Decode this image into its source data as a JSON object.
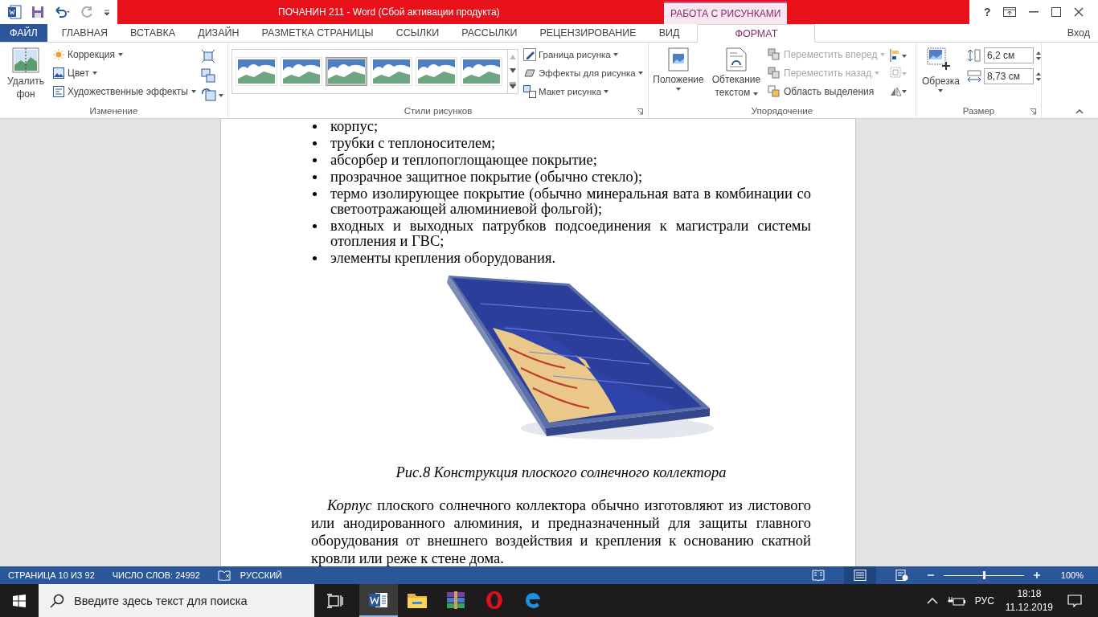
{
  "window": {
    "title": "ПОЧАНИН 211 -  Word (Сбой активации продукта)",
    "context_tab": "РАБОТА С РИСУНКАМИ",
    "help": "?",
    "sign_in": "Вход"
  },
  "tabs": [
    {
      "label": "ФАЙЛ",
      "kind": "file",
      "selected": false
    },
    {
      "label": "ГЛАВНАЯ",
      "kind": "tab",
      "selected": false
    },
    {
      "label": "ВСТАВКА",
      "kind": "tab",
      "selected": false
    },
    {
      "label": "ДИЗАЙН",
      "kind": "tab",
      "selected": false
    },
    {
      "label": "РАЗМЕТКА СТРАНИЦЫ",
      "kind": "tab",
      "selected": false
    },
    {
      "label": "ССЫЛКИ",
      "kind": "tab",
      "selected": false
    },
    {
      "label": "РАССЫЛКИ",
      "kind": "tab",
      "selected": false
    },
    {
      "label": "РЕЦЕНЗИРОВАНИЕ",
      "kind": "tab",
      "selected": false
    },
    {
      "label": "ВИД",
      "kind": "tab",
      "selected": false
    },
    {
      "label": "ФОРМАТ",
      "kind": "context",
      "selected": true
    }
  ],
  "ribbon": {
    "adjust": {
      "title": "Изменение",
      "remove_bg": "Удалить фон",
      "commands": [
        "Коррекция",
        "Цвет",
        "Художественные эффекты"
      ]
    },
    "styles": {
      "title": "Стили рисунков",
      "thumbnails": [
        {
          "selected": false
        },
        {
          "selected": false
        },
        {
          "selected": true
        },
        {
          "selected": false
        },
        {
          "selected": false
        },
        {
          "selected": false
        }
      ],
      "commands": [
        "Граница рисунка",
        "Эффекты для рисунка",
        "Макет рисунка"
      ]
    },
    "arrange": {
      "title": "Упорядочение",
      "position": "Положение",
      "wrap": "Обтекание текстом",
      "commands": [
        {
          "label": "Переместить вперед",
          "disabled": true
        },
        {
          "label": "Переместить назад",
          "disabled": true
        },
        {
          "label": "Область выделения",
          "disabled": false
        }
      ]
    },
    "size": {
      "title": "Размер",
      "crop": "Обрезка",
      "height": "6,2 см",
      "width": "8,73 см"
    }
  },
  "document": {
    "bullets": [
      "корпус;",
      "трубки с теплоносителем;",
      "абсорбер и теплопоглощающее покрытие;",
      "прозрачное защитное покрытие (обычно стекло);",
      "термо изолирующее покрытие (обычно минеральная вата в комбинации со светоотражающей алюминиевой фольгой);",
      "входных и выходных патрубков подсоединения к магистрали системы отопления и ГВС;",
      "элементы крепления оборудования."
    ],
    "figure": {
      "kind": "picture",
      "caption": "Рис.8 Конструкция плоского солнечного коллектора"
    },
    "paragraph": "*Корпус* плоского солнечного коллектора обычно изготовляют из листового или анодированного алюминия, и предназначенный для защиты главного оборудования от внешнего воздействия и крепления к основанию скатной кровли или реже к стене дома."
  },
  "status_bar": {
    "page": "СТРАНИЦА 10 ИЗ 92",
    "words": "ЧИСЛО СЛОВ: 24992",
    "language": "РУССКИЙ",
    "views": [
      {
        "selected": false
      },
      {
        "selected": true
      },
      {
        "selected": false
      }
    ],
    "zoom": {
      "level": 0.5,
      "reading": "100%"
    }
  },
  "taskbar": {
    "search_placeholder": "Введите здесь текст для поиска",
    "apps": [
      {
        "kind": "word",
        "selected": true
      },
      {
        "kind": "folder",
        "selected": false
      },
      {
        "kind": "archive",
        "selected": false
      },
      {
        "kind": "opera",
        "selected": false
      },
      {
        "kind": "edge",
        "selected": false
      }
    ],
    "language": "РУС",
    "time": "18:18",
    "date": "11.12.2019"
  }
}
